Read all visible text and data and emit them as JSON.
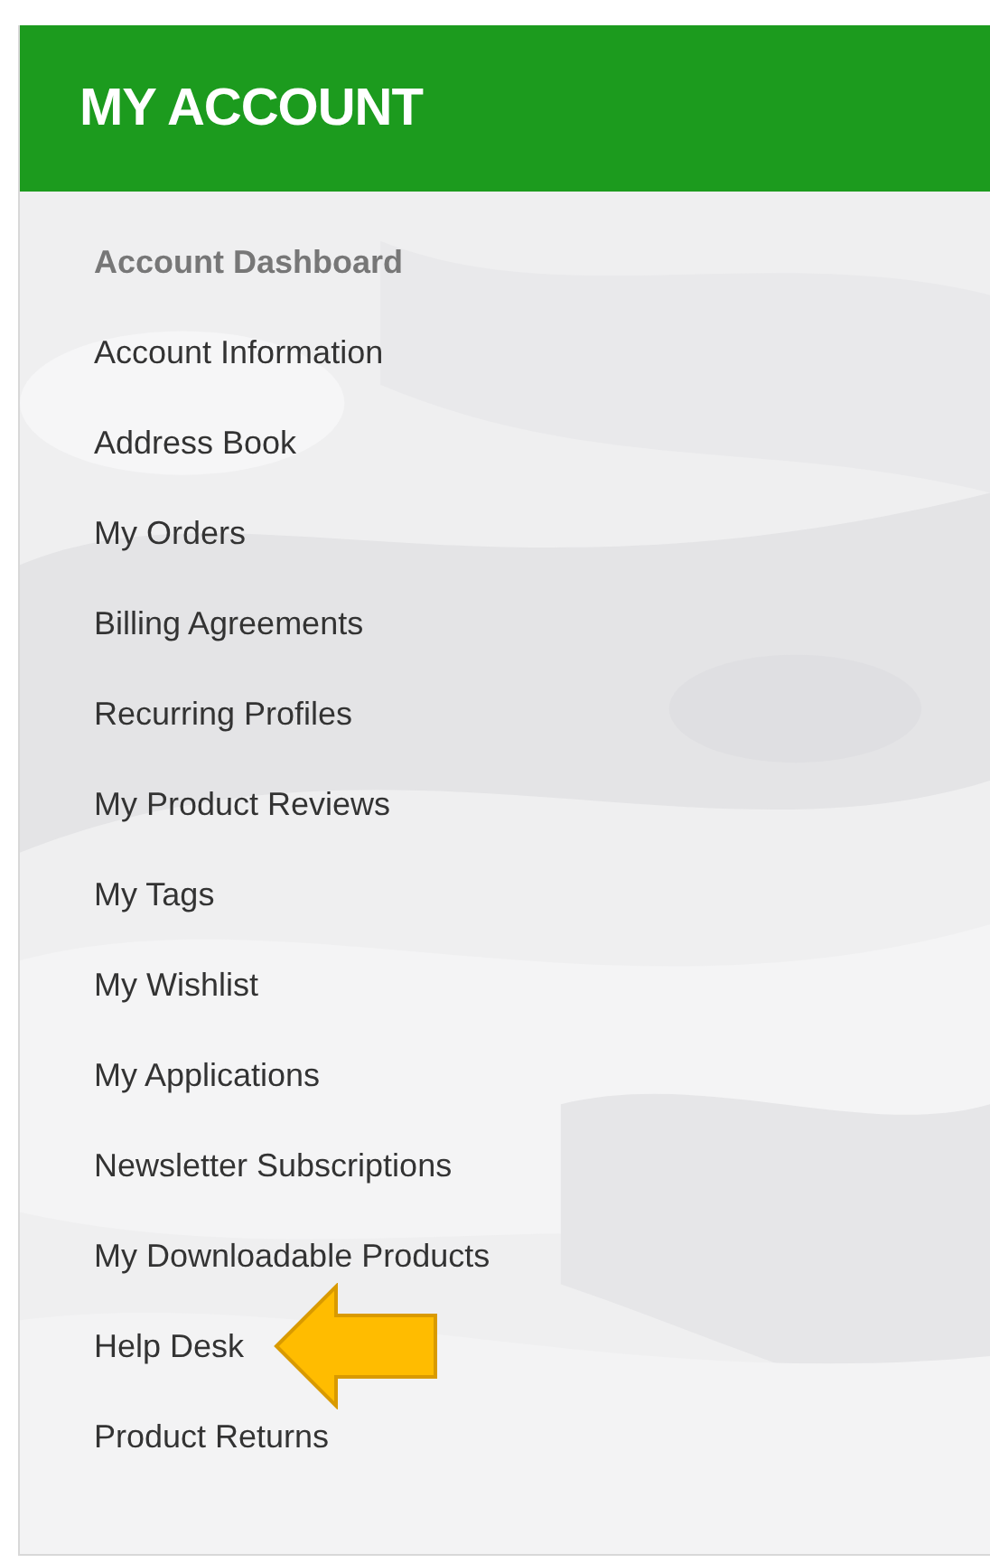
{
  "panel": {
    "title": "MY ACCOUNT"
  },
  "menu": [
    {
      "label": "Account Dashboard",
      "selected": true,
      "highlighted": false
    },
    {
      "label": "Account Information",
      "selected": false,
      "highlighted": false
    },
    {
      "label": "Address Book",
      "selected": false,
      "highlighted": false
    },
    {
      "label": "My Orders",
      "selected": false,
      "highlighted": false
    },
    {
      "label": "Billing Agreements",
      "selected": false,
      "highlighted": false
    },
    {
      "label": "Recurring Profiles",
      "selected": false,
      "highlighted": false
    },
    {
      "label": "My Product Reviews",
      "selected": false,
      "highlighted": false
    },
    {
      "label": "My Tags",
      "selected": false,
      "highlighted": false
    },
    {
      "label": "My Wishlist",
      "selected": false,
      "highlighted": false
    },
    {
      "label": "My Applications",
      "selected": false,
      "highlighted": false
    },
    {
      "label": "Newsletter Subscriptions",
      "selected": false,
      "highlighted": false
    },
    {
      "label": "My Downloadable Products",
      "selected": false,
      "highlighted": false
    },
    {
      "label": "Help Desk",
      "selected": false,
      "highlighted": true
    },
    {
      "label": "Product Returns",
      "selected": false,
      "highlighted": false
    }
  ]
}
